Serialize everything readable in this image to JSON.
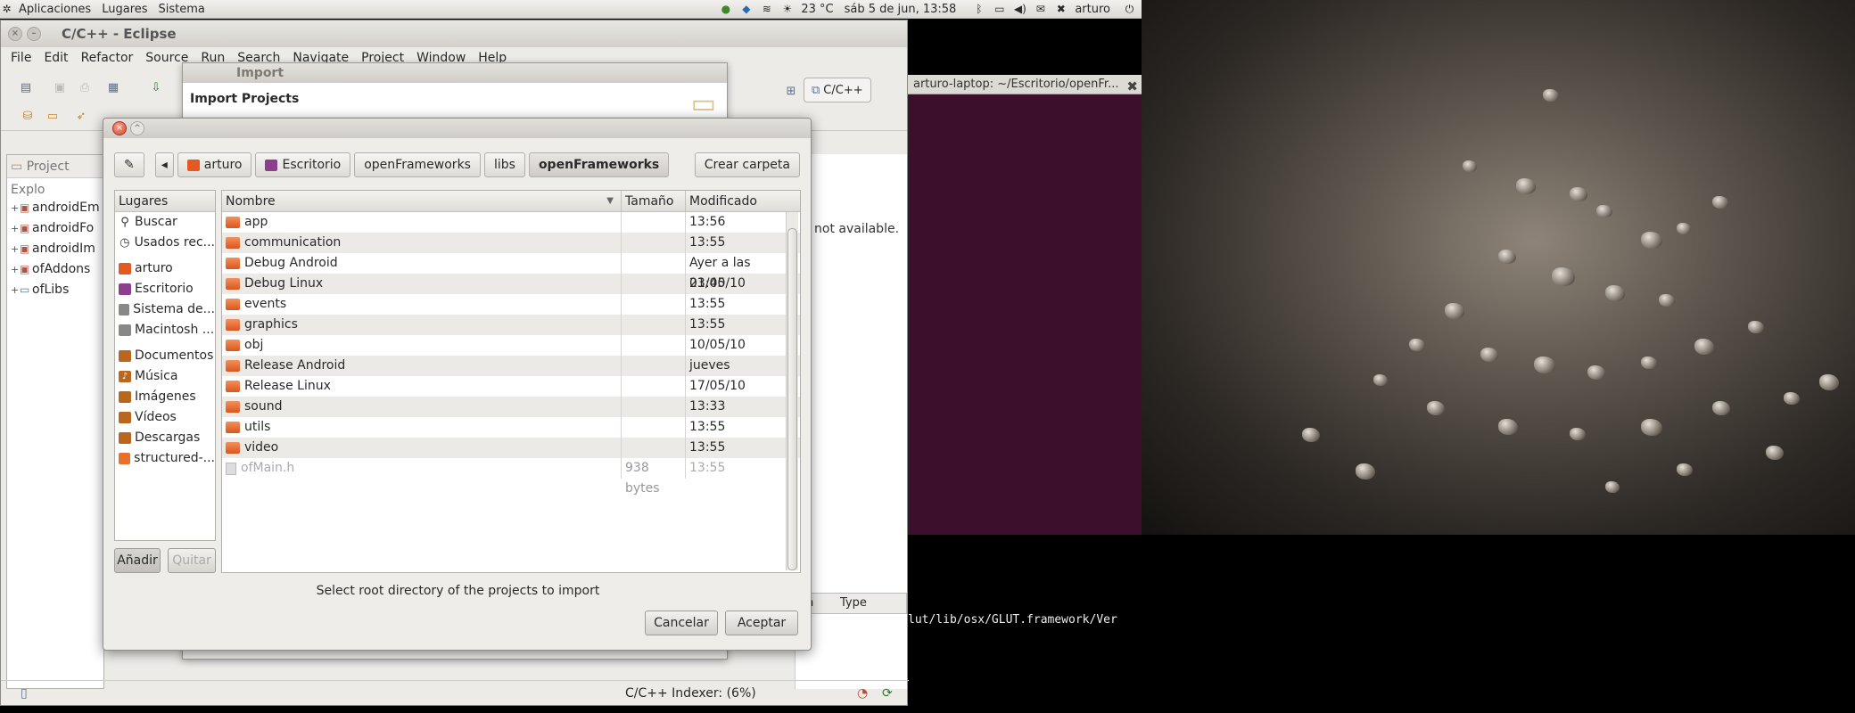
{
  "top_panel": {
    "menus": [
      "Aplicaciones",
      "Lugares",
      "Sistema"
    ],
    "weather": "23 °C",
    "datetime": "sáb 5 de jun, 13:58",
    "user": "arturo"
  },
  "eclipse": {
    "title": "C/C++ - Eclipse",
    "menus": [
      "File",
      "Edit",
      "Refactor",
      "Source",
      "Run",
      "Search",
      "Navigate",
      "Project",
      "Window",
      "Help"
    ],
    "perspective": "C/C++",
    "project_explorer_label": "Project Explo",
    "projects": [
      "androidEm",
      "androidFo",
      "androidIm",
      "ofAddons",
      "ofLibs"
    ],
    "not_available": "not available.",
    "type_column": "Type",
    "col_fragment": "on",
    "indexer": "C/C++ Indexer: (6%)"
  },
  "terminal": {
    "title": "arturo-laptop: ~/Escritorio/openFr...",
    "line": "lut/lib/osx/GLUT.framework/Ver"
  },
  "import_wizard": {
    "title": "Import",
    "heading": "Import Projects"
  },
  "chooser": {
    "path": [
      "arturo",
      "Escritorio",
      "openFrameworks",
      "libs",
      "openFrameworks"
    ],
    "create_folder": "Crear carpeta",
    "places_header": "Lugares",
    "places": [
      {
        "label": "Buscar",
        "icon": "search-icon"
      },
      {
        "label": "Usados rec...",
        "icon": "recent-icon"
      },
      {
        "label": "arturo",
        "icon": "home-folder-icon"
      },
      {
        "label": "Escritorio",
        "icon": "desktop-icon"
      },
      {
        "label": "Sistema de...",
        "icon": "drive-icon"
      },
      {
        "label": "Macintosh ...",
        "icon": "drive-icon"
      },
      {
        "label": "Documentos",
        "icon": "documents-icon"
      },
      {
        "label": "Música",
        "icon": "music-icon"
      },
      {
        "label": "Imágenes",
        "icon": "pictures-icon"
      },
      {
        "label": "Vídeos",
        "icon": "videos-icon"
      },
      {
        "label": "Descargas",
        "icon": "downloads-icon"
      },
      {
        "label": "structured-...",
        "icon": "folder-icon"
      }
    ],
    "add": "Añadir",
    "remove": "Quitar",
    "columns": {
      "name": "Nombre",
      "size": "Tamaño",
      "modified": "Modificado"
    },
    "files": [
      {
        "name": "app",
        "size": "",
        "modified": "13:56"
      },
      {
        "name": "communication",
        "size": "",
        "modified": "13:55"
      },
      {
        "name": "Debug Android",
        "size": "",
        "modified": "Ayer a las 01:40"
      },
      {
        "name": "Debug Linux",
        "size": "",
        "modified": "23/05/10"
      },
      {
        "name": "events",
        "size": "",
        "modified": "13:55"
      },
      {
        "name": "graphics",
        "size": "",
        "modified": "13:55"
      },
      {
        "name": "obj",
        "size": "",
        "modified": "10/05/10"
      },
      {
        "name": "Release Android",
        "size": "",
        "modified": "jueves"
      },
      {
        "name": "Release Linux",
        "size": "",
        "modified": "17/05/10"
      },
      {
        "name": "sound",
        "size": "",
        "modified": "13:33"
      },
      {
        "name": "utils",
        "size": "",
        "modified": "13:55"
      },
      {
        "name": "video",
        "size": "",
        "modified": "13:55"
      },
      {
        "name": "ofMain.h",
        "size": "938 bytes",
        "modified": "13:55"
      }
    ],
    "message": "Select root directory of the projects to import",
    "cancel": "Cancelar",
    "accept": "Aceptar"
  }
}
